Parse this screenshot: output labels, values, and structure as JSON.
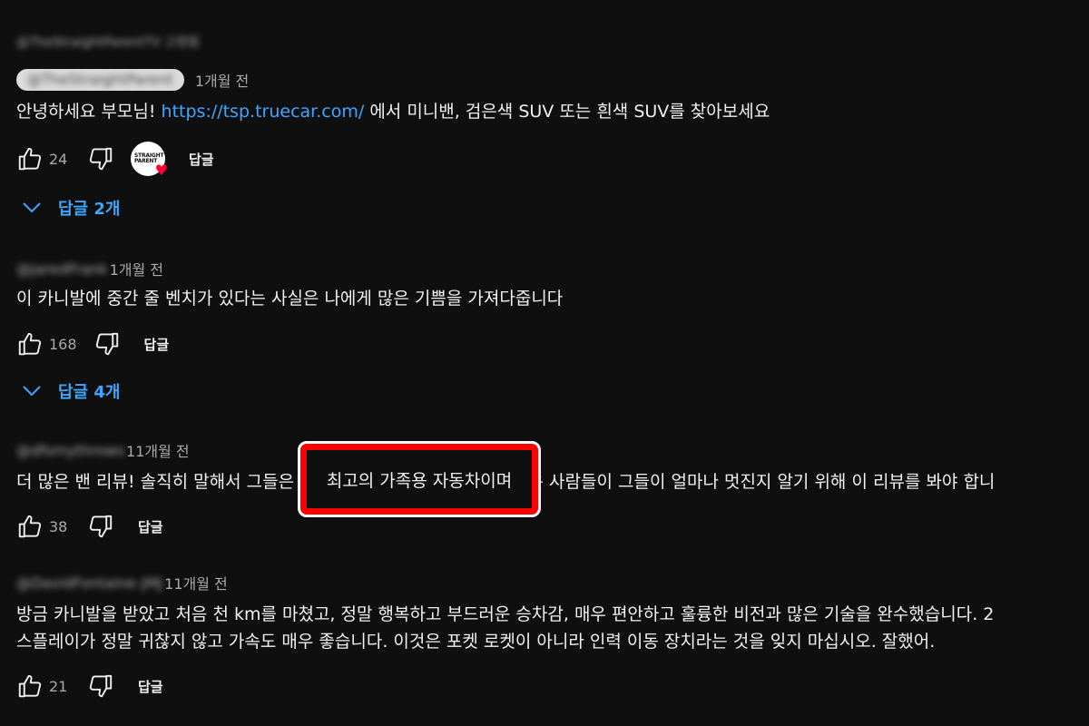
{
  "header_fragment": "@TheStraightParentTV 고정됨",
  "comments": [
    {
      "author": "@TheStraightParent",
      "time": "1개월 전",
      "text_before_link": "안녕하세요 부모님! ",
      "link": "https://tsp.truecar.com/",
      "text_after_link": " 에서 미니밴, 검은색 SUV 또는 흰색 SUV를 찾아보세요",
      "likes": "24",
      "reply_label": "답글",
      "avatar_text": "STRAIGHT PARENT",
      "replies_label": "답글 2개"
    },
    {
      "author": "@JaredFrank",
      "time": "1개월 전",
      "text": "이 카니발에 중간 줄 벤치가 있다는 사실은 나에게 많은 기쁨을 가져다줍니다",
      "likes": "168",
      "reply_label": "답글",
      "replies_label": "답글 4개"
    },
    {
      "author": "@dfsmythrows",
      "time": "11개월 전",
      "text_before": "더 많은 밴 리뷰! 솔직히 말해서 그들은 ",
      "highlight": "최고의 가족용 자동차이며",
      "text_after": " 더 많은 사람들이 그들이 얼마나 멋진지 알기 위해 이 리뷰를 봐야 합니",
      "likes": "38",
      "reply_label": "답글"
    },
    {
      "author": "@DavidFontaine-JMJ",
      "time": "11개월 전",
      "line1": "방금 카니발을 받았고 처음 천 km를 마쳤고, 정말 행복하고 부드러운 승차감, 매우 편안하고 훌륭한 비전과 많은 기술을 완수했습니다. 2",
      "line2": "스플레이가 정말 귀찮지 않고 가속도 매우 좋습니다. 이것은 포켓 로켓이 아니라 인력 이동 장치라는 것을 잊지 마십시오. 잘했어.",
      "likes": "21",
      "reply_label": "답글"
    }
  ],
  "highlight_color": "#ff0000",
  "link_color": "#3ea6ff",
  "icons": {
    "like": "thumbs-up-icon",
    "dislike": "thumbs-down-icon",
    "expand": "chevron-down-icon",
    "heart": "heart-icon"
  }
}
